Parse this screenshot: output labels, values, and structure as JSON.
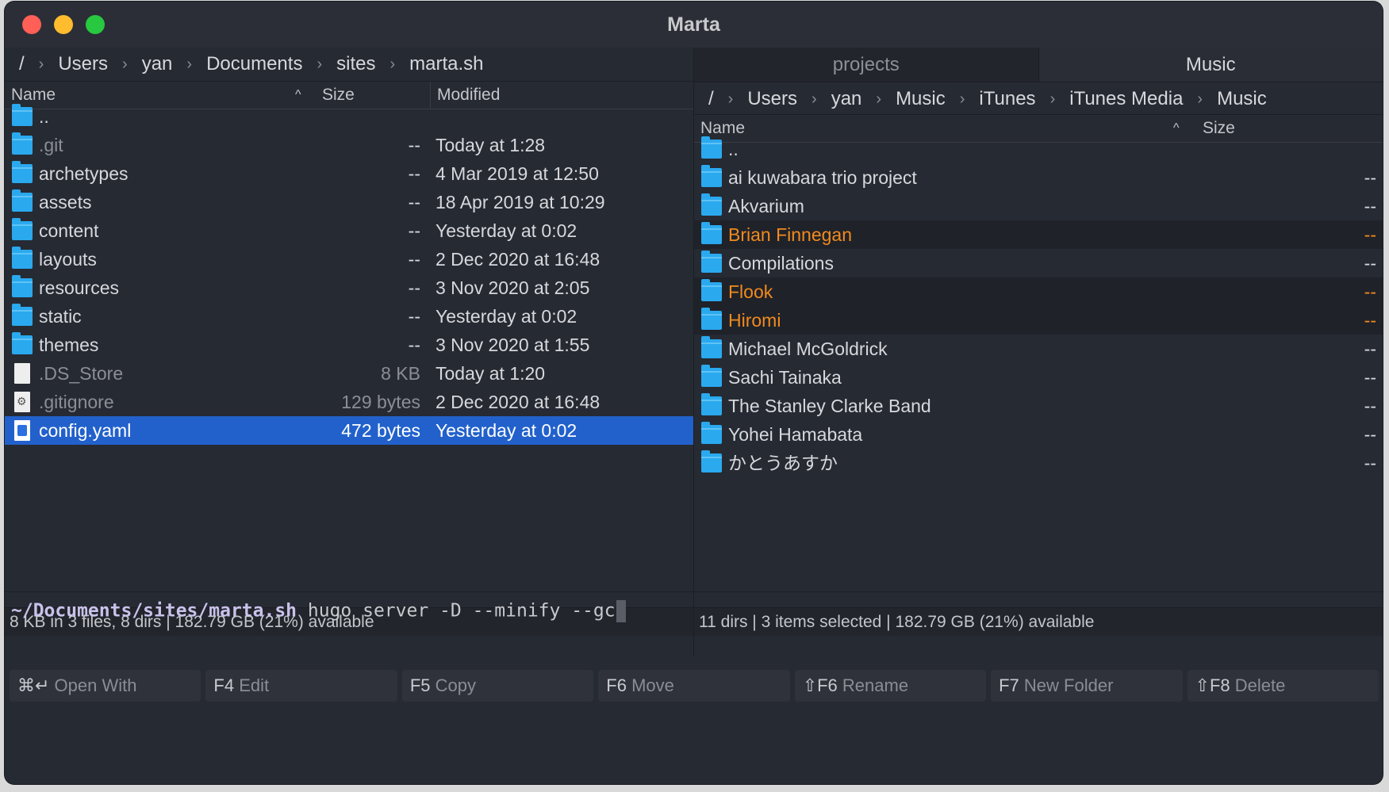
{
  "window": {
    "title": "Marta"
  },
  "left": {
    "breadcrumb": [
      "/",
      "Users",
      "yan",
      "Documents",
      "sites",
      "marta.sh"
    ],
    "columns": {
      "name": "Name",
      "size": "Size",
      "modified": "Modified"
    },
    "rows": [
      {
        "icon": "folder-icon",
        "name": "..",
        "size": "",
        "modified": "",
        "style": "normal"
      },
      {
        "icon": "folder-icon",
        "name": ".git",
        "size": "--",
        "modified": "Today at 1:28",
        "style": "dim"
      },
      {
        "icon": "folder-icon",
        "name": "archetypes",
        "size": "--",
        "modified": "4 Mar 2019 at 12:50",
        "style": "normal"
      },
      {
        "icon": "folder-icon",
        "name": "assets",
        "size": "--",
        "modified": "18 Apr 2019 at 10:29",
        "style": "normal"
      },
      {
        "icon": "folder-icon",
        "name": "content",
        "size": "--",
        "modified": "Yesterday at 0:02",
        "style": "normal"
      },
      {
        "icon": "folder-icon",
        "name": "layouts",
        "size": "--",
        "modified": "2 Dec 2020 at 16:48",
        "style": "normal"
      },
      {
        "icon": "folder-icon",
        "name": "resources",
        "size": "--",
        "modified": "3 Nov 2020 at 2:05",
        "style": "normal"
      },
      {
        "icon": "folder-icon",
        "name": "static",
        "size": "--",
        "modified": "Yesterday at 0:02",
        "style": "normal"
      },
      {
        "icon": "folder-icon",
        "name": "themes",
        "size": "--",
        "modified": "3 Nov 2020 at 1:55",
        "style": "normal"
      },
      {
        "icon": "file-icon",
        "name": ".DS_Store",
        "size": "8 KB",
        "modified": "Today at 1:20",
        "style": "dim"
      },
      {
        "icon": "settings-file-icon",
        "name": ".gitignore",
        "size": "129 bytes",
        "modified": "2 Dec 2020 at 16:48",
        "style": "dim"
      },
      {
        "icon": "yaml-file-icon",
        "name": "config.yaml",
        "size": "472 bytes",
        "modified": "Yesterday at 0:02",
        "style": "selected"
      }
    ],
    "status": "8 KB in 3 files, 8 dirs  |  182.79 GB (21%) available"
  },
  "right": {
    "tabs": [
      "projects",
      "Music"
    ],
    "active_tab": "Music",
    "breadcrumb": [
      "/",
      "Users",
      "yan",
      "Music",
      "iTunes",
      "iTunes Media",
      "Music"
    ],
    "columns": {
      "name": "Name",
      "size": "Size"
    },
    "rows": [
      {
        "icon": "folder-icon",
        "name": "..",
        "size": "",
        "style": "normal"
      },
      {
        "icon": "folder-icon",
        "name": "ai kuwabara trio project",
        "size": "--",
        "style": "normal"
      },
      {
        "icon": "folder-icon",
        "name": "Akvarium",
        "size": "--",
        "style": "normal"
      },
      {
        "icon": "folder-icon",
        "name": "Brian Finnegan",
        "size": "--",
        "style": "marked"
      },
      {
        "icon": "folder-icon",
        "name": "Compilations",
        "size": "--",
        "style": "normal"
      },
      {
        "icon": "folder-icon",
        "name": "Flook",
        "size": "--",
        "style": "marked"
      },
      {
        "icon": "folder-icon",
        "name": "Hiromi",
        "size": "--",
        "style": "marked"
      },
      {
        "icon": "folder-icon",
        "name": "Michael McGoldrick",
        "size": "--",
        "style": "normal"
      },
      {
        "icon": "folder-icon",
        "name": "Sachi Tainaka",
        "size": "--",
        "style": "normal"
      },
      {
        "icon": "folder-icon",
        "name": "The Stanley Clarke Band",
        "size": "--",
        "style": "normal"
      },
      {
        "icon": "folder-icon",
        "name": "Yohei Hamabata",
        "size": "--",
        "style": "normal"
      },
      {
        "icon": "folder-icon",
        "name": "かとうあすか",
        "size": "--",
        "style": "normal"
      }
    ],
    "status": "11 dirs  |  3 items selected  |  182.79 GB (21%) available"
  },
  "console": {
    "cwd": "~/Documents/sites/marta.sh",
    "command": " hugo server -D --minify --gc"
  },
  "fkeys": [
    {
      "key": "⌘↵",
      "label": " Open With"
    },
    {
      "key": "F4",
      "label": " Edit"
    },
    {
      "key": "F5",
      "label": " Copy"
    },
    {
      "key": "F6",
      "label": " Move"
    },
    {
      "key": "⇧F6",
      "label": " Rename"
    },
    {
      "key": "F7",
      "label": " New Folder"
    },
    {
      "key": "⇧F8",
      "label": " Delete"
    }
  ],
  "colors": {
    "selection": "#2261cc",
    "marked": "#f28a1e",
    "folder": "#2aa9ef",
    "background": "#262a33"
  }
}
